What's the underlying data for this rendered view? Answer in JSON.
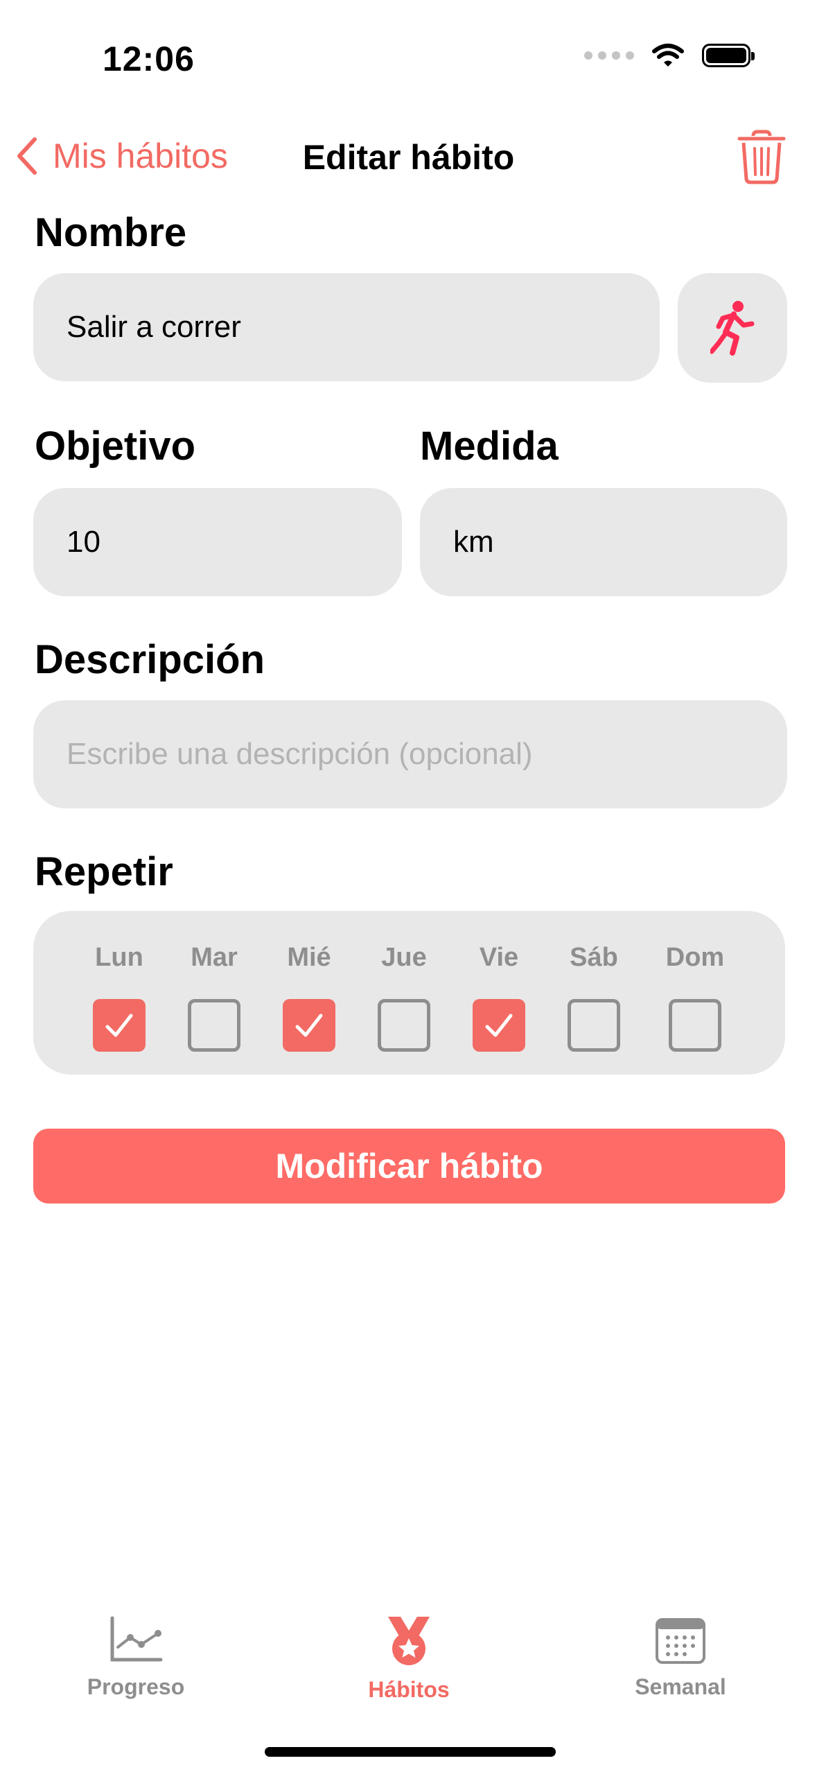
{
  "status_bar": {
    "time": "12:06"
  },
  "nav": {
    "back_label": "Mis hábitos",
    "title": "Editar hábito"
  },
  "form": {
    "name_label": "Nombre",
    "name_value": "Salir a correr",
    "icon": "running-figure-icon",
    "goal_label": "Objetivo",
    "goal_value": "10",
    "unit_label": "Medida",
    "unit_value": "km",
    "description_label": "Descripción",
    "description_placeholder": "Escribe una descripción (opcional)",
    "repeat_label": "Repetir",
    "days": [
      {
        "label": "Lun",
        "checked": true
      },
      {
        "label": "Mar",
        "checked": false
      },
      {
        "label": "Mié",
        "checked": true
      },
      {
        "label": "Jue",
        "checked": false
      },
      {
        "label": "Vie",
        "checked": true
      },
      {
        "label": "Sáb",
        "checked": false
      },
      {
        "label": "Dom",
        "checked": false
      }
    ],
    "submit_label": "Modificar hábito"
  },
  "tabs": [
    {
      "label": "Progreso",
      "icon": "chart-line-icon",
      "active": false
    },
    {
      "label": "Hábitos",
      "icon": "medal-icon",
      "active": true
    },
    {
      "label": "Semanal",
      "icon": "calendar-icon",
      "active": false
    }
  ],
  "colors": {
    "accent": "#f26a63",
    "field_bg": "#e8e8e8",
    "muted": "#8e8e8e",
    "submit_bg": "#ff6b66"
  }
}
